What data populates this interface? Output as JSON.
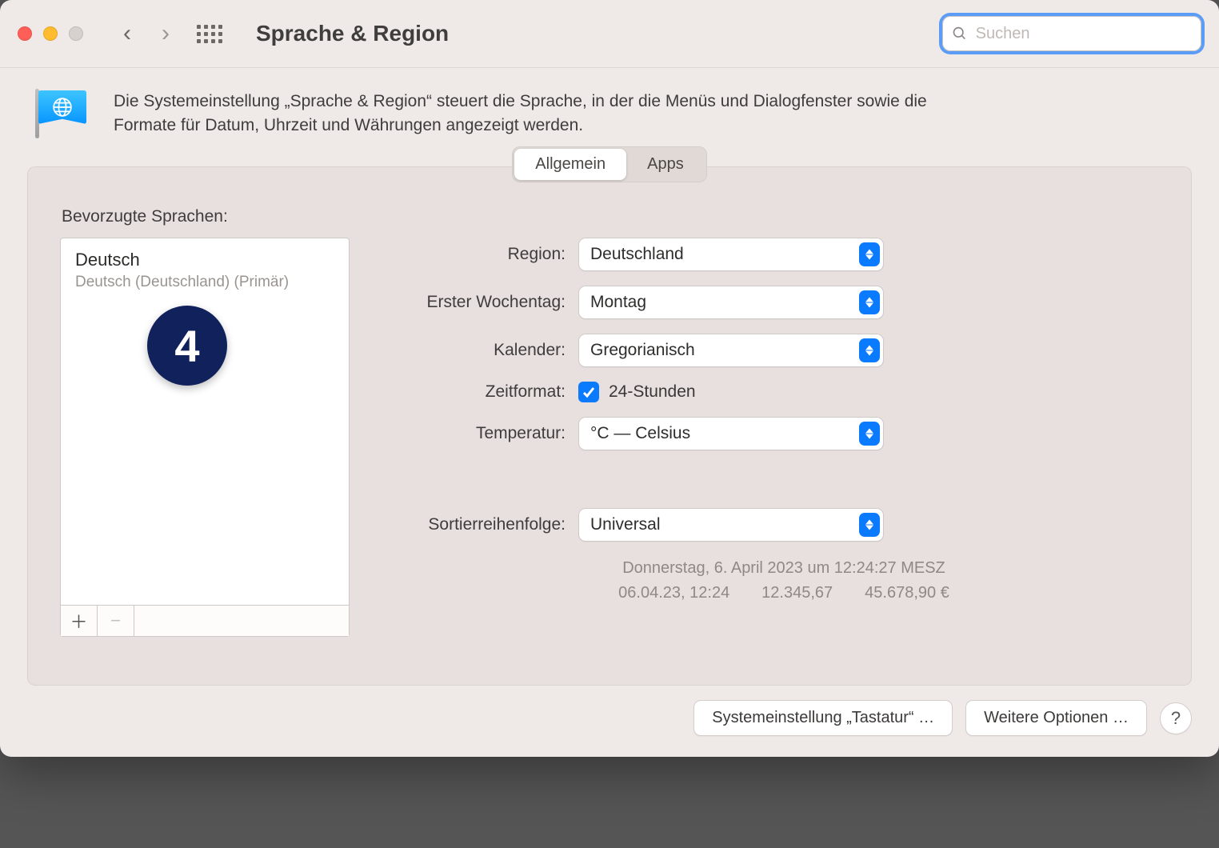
{
  "window": {
    "title": "Sprache & Region",
    "search_placeholder": "Suchen"
  },
  "description": "Die Systemeinstellung „Sprache & Region“ steuert die Sprache, in der die Menüs und Dialogfenster sowie die Formate für Datum, Uhrzeit und Währungen angezeigt werden.",
  "tabs": {
    "general": "Allgemein",
    "apps": "Apps"
  },
  "preferred_languages_label": "Bevorzugte Sprachen:",
  "languages": [
    {
      "name": "Deutsch",
      "sub": "Deutsch (Deutschland) (Primär)"
    }
  ],
  "annotation_badge": "4",
  "settings": {
    "region_label": "Region:",
    "region_value": "Deutschland",
    "first_weekday_label": "Erster Wochentag:",
    "first_weekday_value": "Montag",
    "calendar_label": "Kalender:",
    "calendar_value": "Gregorianisch",
    "time_format_label": "Zeitformat:",
    "time_format_checkbox_label": "24-Stunden",
    "time_format_checked": true,
    "temperature_label": "Temperatur:",
    "temperature_value": "°C — Celsius",
    "sort_order_label": "Sortierreihenfolge:",
    "sort_order_value": "Universal"
  },
  "example_line1": "Donnerstag, 6. April 2023 um 12:24:27 MESZ",
  "example_line2": "06.04.23, 12:24  12.345,67  45.678,90 €",
  "footer": {
    "keyboard_button": "Systemeinstellung „Tastatur“ …",
    "more_options_button": "Weitere Optionen …"
  }
}
